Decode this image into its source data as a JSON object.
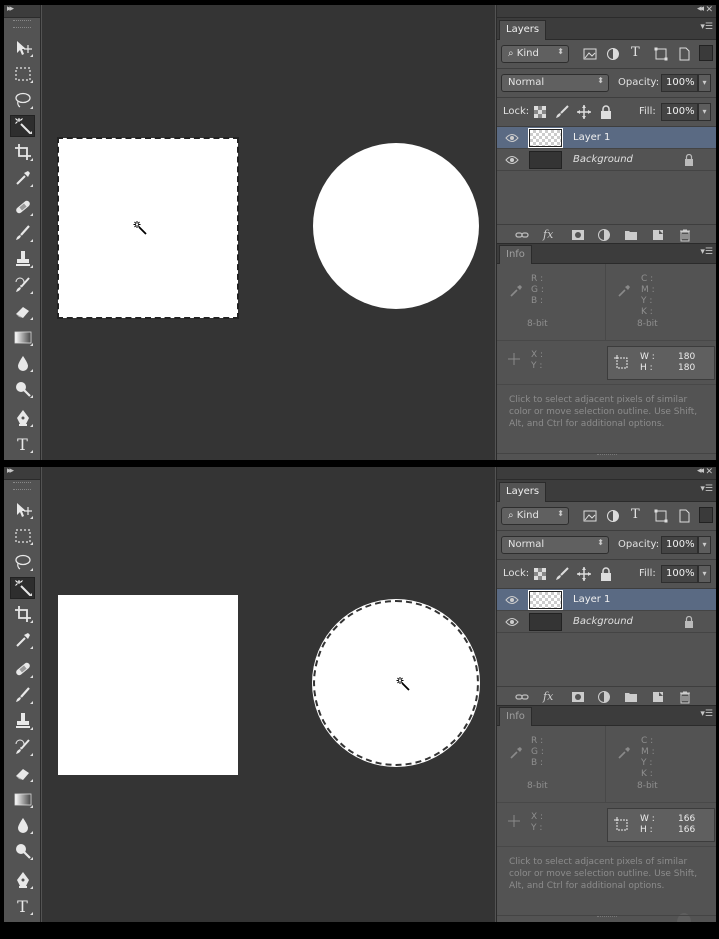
{
  "panels": {
    "top": {
      "tab_layers": "Layers",
      "filter_kind": "Kind",
      "blend_mode": "Normal",
      "opacity_label": "Opacity:",
      "opacity_value": "100%",
      "lock_label": "Lock:",
      "fill_label": "Fill:",
      "fill_value": "100%",
      "layers": [
        {
          "name": "Layer 1",
          "selected": true
        },
        {
          "name": "Background",
          "selected": false
        }
      ],
      "info_tab": "Info",
      "info": {
        "r": "R :",
        "g": "G :",
        "b": "B :",
        "bit1": "8-bit",
        "c": "C :",
        "m": "M :",
        "y": "Y :",
        "k": "K :",
        "bit2": "8-bit",
        "x": "X :",
        "yy": "Y :",
        "w_label": "W :",
        "h_label": "H :",
        "w_value": "180",
        "h_value": "180"
      },
      "help_text": "Click to select adjacent pixels of similar color or move selection outline.  Use Shift, Alt, and Ctrl for additional options."
    },
    "bottom": {
      "tab_layers": "Layers",
      "filter_kind": "Kind",
      "blend_mode": "Normal",
      "opacity_label": "Opacity:",
      "opacity_value": "100%",
      "lock_label": "Lock:",
      "fill_label": "Fill:",
      "fill_value": "100%",
      "layers": [
        {
          "name": "Layer 1",
          "selected": true
        },
        {
          "name": "Background",
          "selected": false
        }
      ],
      "info_tab": "Info",
      "info": {
        "r": "R :",
        "g": "G :",
        "b": "B :",
        "bit1": "8-bit",
        "c": "C :",
        "m": "M :",
        "y": "Y :",
        "k": "K :",
        "bit2": "8-bit",
        "x": "X :",
        "yy": "Y :",
        "w_label": "W :",
        "h_label": "H :",
        "w_value": "166",
        "h_value": "166"
      },
      "help_text": "Click to select adjacent pixels of similar color or move selection outline.  Use Shift, Alt, and Ctrl for additional options."
    }
  },
  "tools": [
    "move-tool",
    "rectangular-marquee-tool",
    "lasso-tool",
    "magic-wand-tool",
    "crop-tool",
    "eyedropper-tool",
    "healing-brush-tool",
    "brush-tool",
    "clone-stamp-tool",
    "history-brush-tool",
    "eraser-tool",
    "gradient-tool",
    "blur-tool",
    "dodge-tool",
    "pen-tool",
    "type-tool"
  ],
  "tool_glyphs": {
    "type": "T"
  },
  "colors": {
    "ui_bg": "#535353",
    "canvas_bg": "#343434",
    "selected_layer": "#5a6a83",
    "panel_header": "#3c3c3c"
  }
}
